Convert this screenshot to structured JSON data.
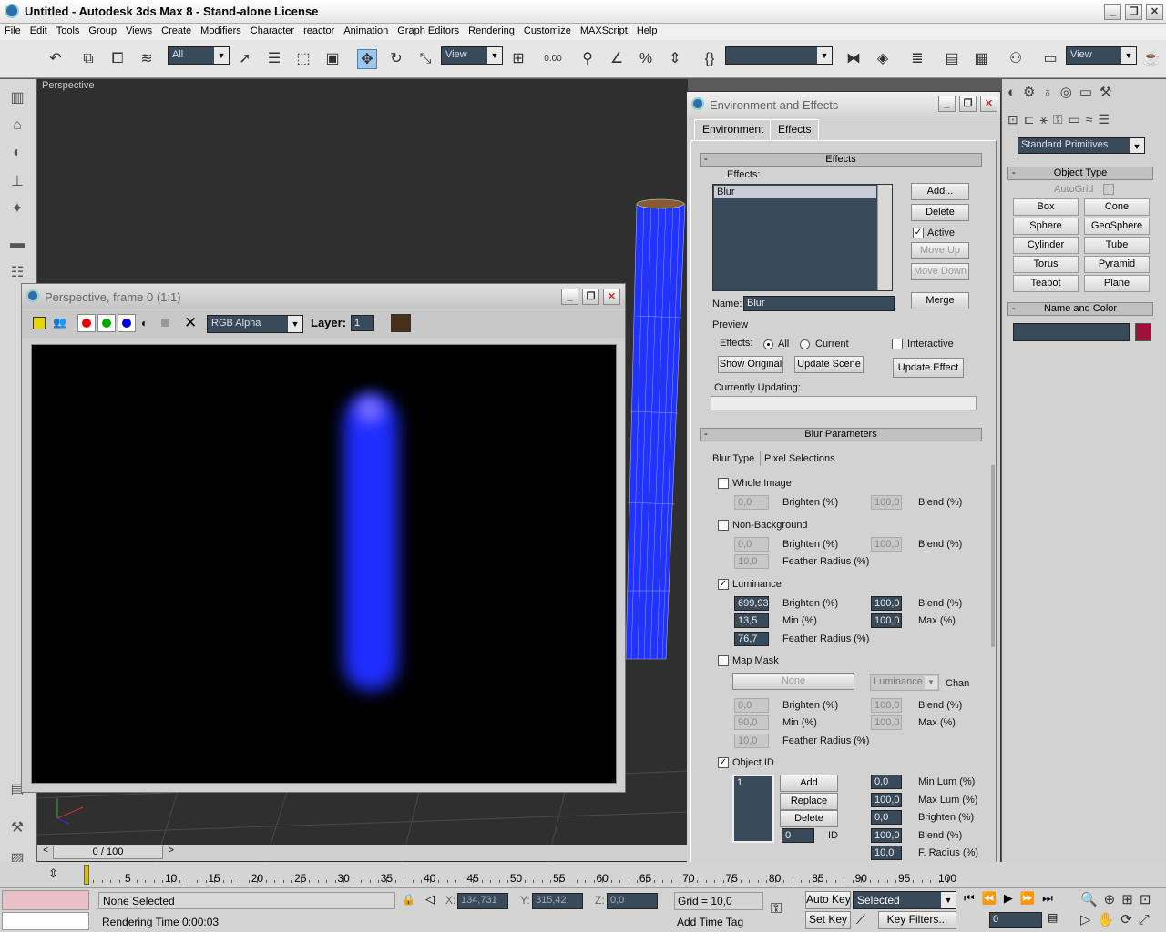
{
  "app": {
    "title": "Untitled  - Autodesk 3ds Max 8  - Stand-alone License"
  },
  "menu": [
    "File",
    "Edit",
    "Tools",
    "Group",
    "Views",
    "Create",
    "Modifiers",
    "Character",
    "reactor",
    "Animation",
    "Graph Editors",
    "Rendering",
    "Customize",
    "MAXScript",
    "Help"
  ],
  "toolbar": {
    "selection_filter": "All",
    "ref_coord": "View",
    "named_sel": "",
    "view_dropdown": "View"
  },
  "viewport": {
    "label": "Perspective"
  },
  "render_frame": {
    "title": "Perspective, frame 0 (1:1)",
    "channel": "RGB Alpha",
    "layer_label": "Layer:",
    "layer_value": "1",
    "swatch_color": "#4a3018"
  },
  "env": {
    "title": "Environment and Effects",
    "tabs": [
      "Environment",
      "Effects"
    ],
    "effects_rollout": "Effects",
    "effects_label": "Effects:",
    "effects_list": [
      "Blur"
    ],
    "btn_add": "Add...",
    "btn_delete": "Delete",
    "active_label": "Active",
    "btn_moveup": "Move Up",
    "btn_movedown": "Move Down",
    "name_label": "Name:",
    "name_value": "Blur",
    "btn_merge": "Merge",
    "preview_label": "Preview",
    "preview_effects_label": "Effects:",
    "radio_all": "All",
    "radio_current": "Current",
    "interactive_label": "Interactive",
    "btn_show_original": "Show Original",
    "btn_update_scene": "Update Scene",
    "btn_update_effect": "Update Effect",
    "currently_updating": "Currently Updating:",
    "blur_rollout": "Blur Parameters",
    "blur_tabs": [
      "Blur Type",
      "Pixel Selections"
    ],
    "whole_image": {
      "label": "Whole Image",
      "brighten": "0,0",
      "blend": "100,0"
    },
    "non_background": {
      "label": "Non-Background",
      "brighten": "0,0",
      "blend": "100,0",
      "feather": "10,0"
    },
    "luminance": {
      "label": "Luminance",
      "brighten": "699,93",
      "blend": "100,0",
      "min": "13,5",
      "max": "100,0",
      "feather": "76,7"
    },
    "map_mask": {
      "label": "Map Mask",
      "map": "None",
      "channel": "Luminance",
      "chan_label": "Chan",
      "brighten": "0,0",
      "blend": "100,0",
      "min": "90,0",
      "max": "100,0",
      "feather": "10,0"
    },
    "object_id": {
      "label": "Object ID",
      "list": [
        "1"
      ],
      "btn_add": "Add",
      "btn_replace": "Replace",
      "btn_delete": "Delete",
      "id": "0",
      "min_lum": "0,0",
      "max_lum": "100,0",
      "brighten": "0,0",
      "blend": "100,0",
      "f_radius": "10,0"
    },
    "labels": {
      "brighten": "Brighten (%)",
      "blend": "Blend (%)",
      "feather": "Feather Radius (%)",
      "min": "Min (%)",
      "max": "Max (%)",
      "min_lum": "Min Lum (%)",
      "max_lum": "Max Lum (%)",
      "id": "ID",
      "f_radius": "F. Radius (%)"
    }
  },
  "command_panel": {
    "category": "Standard Primitives",
    "object_type_rollout": "Object Type",
    "autogrid": "AutoGrid",
    "buttons": [
      "Box",
      "Cone",
      "Sphere",
      "GeoSphere",
      "Cylinder",
      "Tube",
      "Torus",
      "Pyramid",
      "Teapot",
      "Plane"
    ],
    "name_color_rollout": "Name and Color",
    "object_color": "#a0103a"
  },
  "timeline": {
    "frame": "0 / 100",
    "ticks": [
      "5",
      "10",
      "15",
      "20",
      "25",
      "30",
      "35",
      "40",
      "45",
      "50",
      "55",
      "60",
      "65",
      "70",
      "75",
      "80",
      "85",
      "90",
      "95",
      "100"
    ]
  },
  "status": {
    "selection": "None Selected",
    "render_time": "Rendering Time  0:00:03",
    "x_label": "X:",
    "x_value": "134,731",
    "y_label": "Y:",
    "y_value": "315,42",
    "z_label": "Z:",
    "z_value": "0,0",
    "grid": "Grid = 10,0",
    "add_time_tag": "Add Time Tag",
    "auto_key": "Auto Key",
    "selected": "Selected",
    "set_key": "Set Key",
    "key_filters": "Key Filters...",
    "frame_field": "0"
  }
}
